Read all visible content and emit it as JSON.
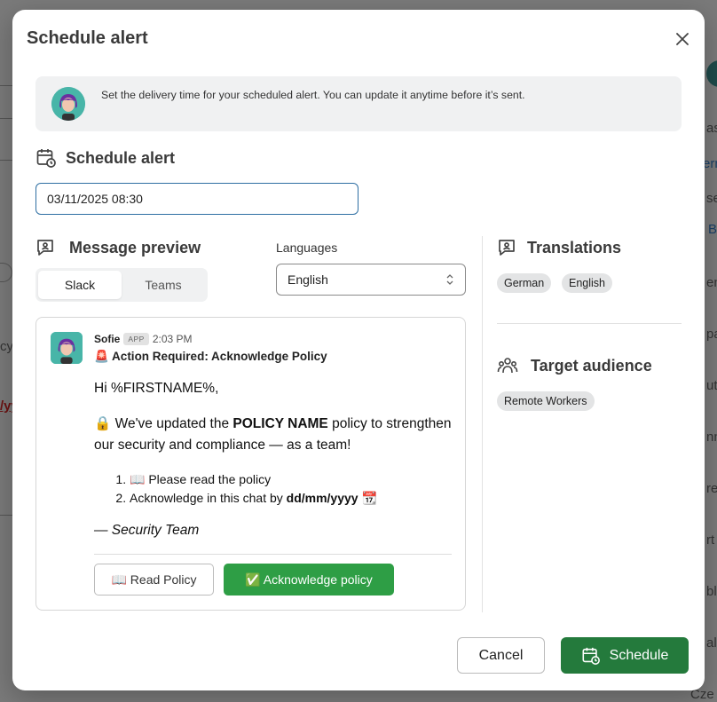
{
  "modal": {
    "title": "Schedule alert",
    "close_icon": "close-icon"
  },
  "banner": {
    "text": "Set the delivery time for your scheduled alert. You can update it anytime before it’s sent."
  },
  "schedule": {
    "heading": "Schedule alert",
    "datetime_value": "03/11/2025 08:30"
  },
  "preview": {
    "heading": "Message preview",
    "tabs": [
      {
        "label": "Slack",
        "active": true
      },
      {
        "label": "Teams",
        "active": false
      }
    ]
  },
  "languages": {
    "label": "Languages",
    "selected": "English"
  },
  "message": {
    "sender": "Sofie",
    "app_badge": "APP",
    "time": "2:03 PM",
    "subject": "🚨 Action Required: Acknowledge Policy",
    "greeting": "Hi %FIRSTNAME%,",
    "intro_prefix": "🔒 We've updated the ",
    "intro_bold": "POLICY NAME",
    "intro_suffix": " policy to strengthen our security and compliance — as a team!",
    "step1": "📖 Please read the policy",
    "step2_prefix": "Acknowledge in this chat by ",
    "step2_bold": "dd/mm/yyyy",
    "step2_suffix": " 📆",
    "sign_off": "— Security Team",
    "read_button": "📖 Read Policy",
    "ack_button": "✅ Acknowledge policy"
  },
  "translations": {
    "heading": "Translations",
    "chips": [
      "German",
      "English"
    ]
  },
  "audience": {
    "heading": "Target audience",
    "chips": [
      "Remote Workers"
    ]
  },
  "footer": {
    "cancel_label": "Cancel",
    "schedule_label": "Schedule"
  },
  "background": {
    "fragments": [
      "ase",
      "ern",
      "se",
      "B",
      "en",
      "pa",
      "uto",
      "nn",
      "red",
      "rt",
      "blis",
      "alia",
      "Cze",
      "cy",
      "/yy"
    ]
  },
  "colors": {
    "primary_green": "#247a3c",
    "ack_green": "#2e9e45",
    "input_border": "#2f6fa3",
    "link_blue": "#2f6fa3"
  }
}
